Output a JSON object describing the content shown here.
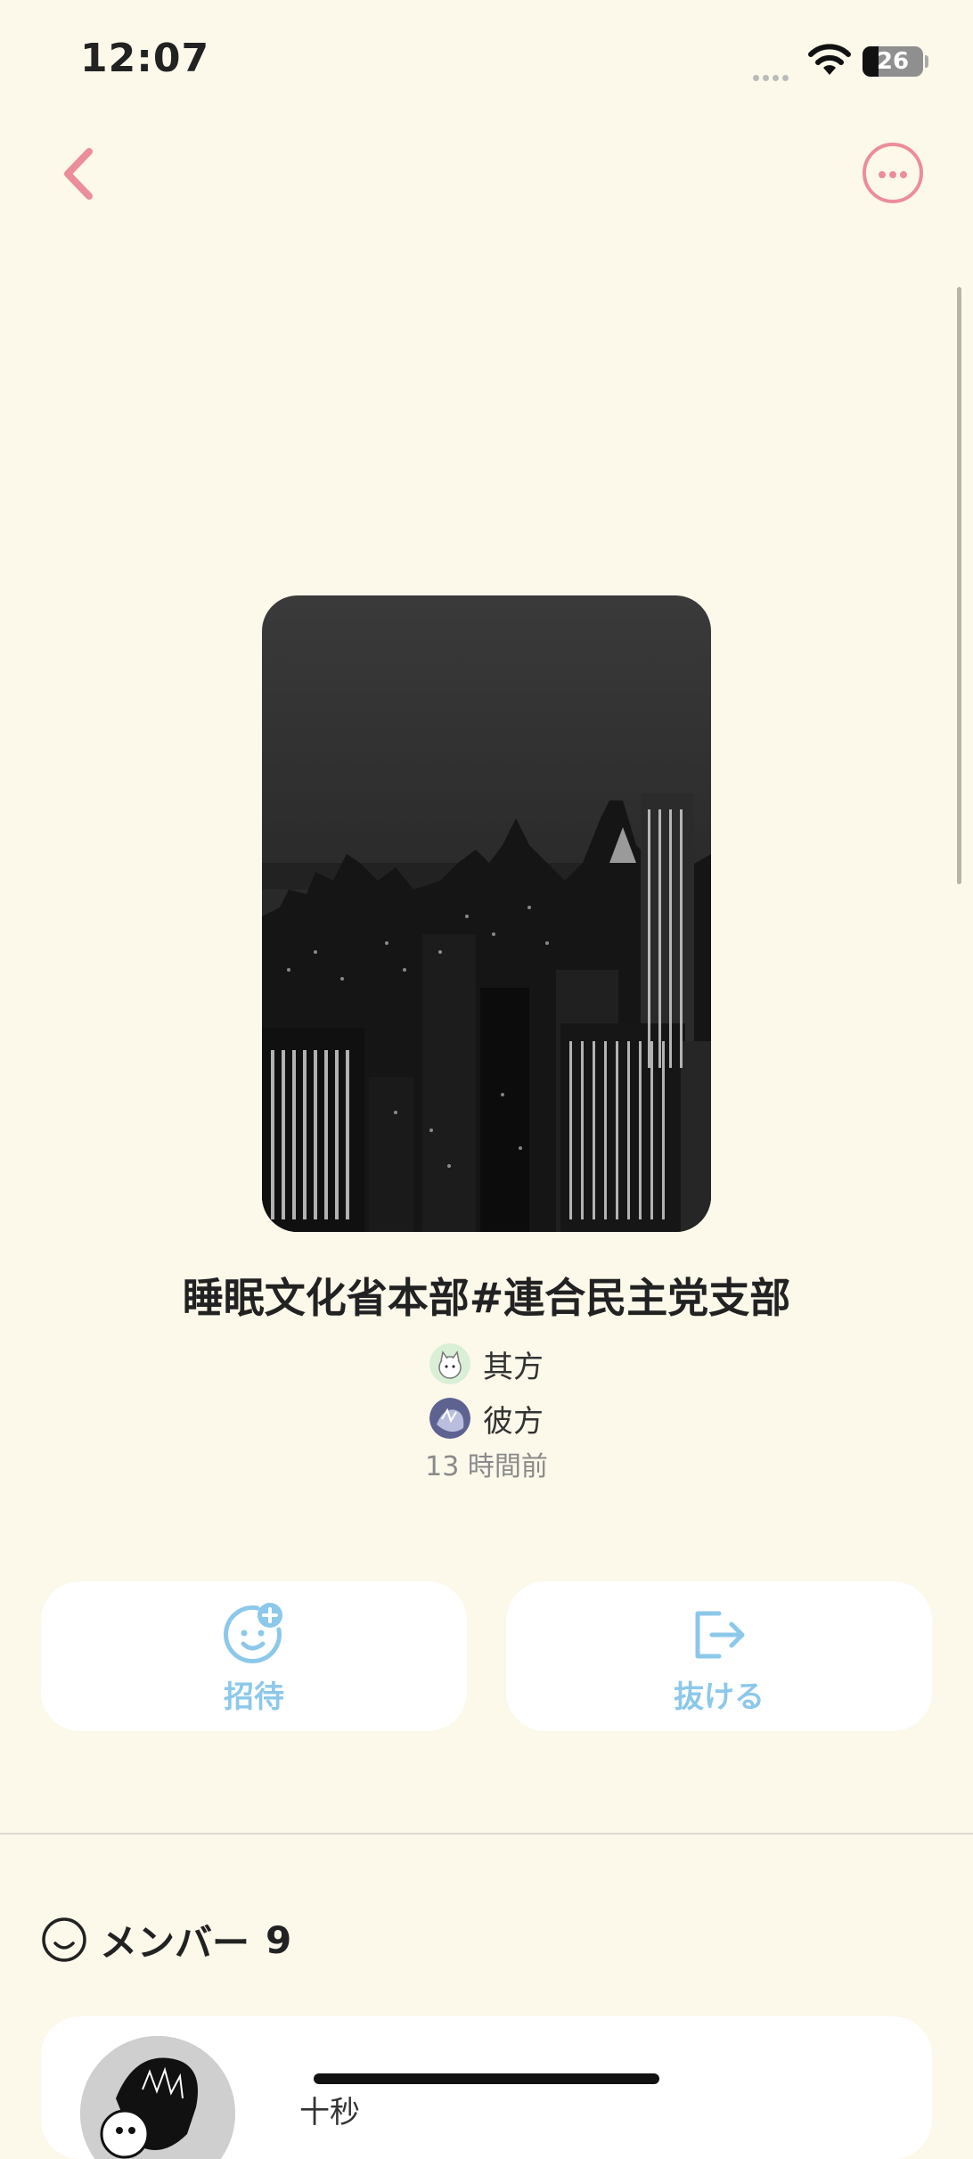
{
  "status_bar": {
    "time": "12:07",
    "battery": "26",
    "battery_fraction": 0.26
  },
  "header": {
    "back_icon": "chevron-left-icon",
    "more_icon": "ellipsis-circle-icon",
    "accent_color": "#eb8d9a"
  },
  "group": {
    "title": "睡眠文化省本部#連合民主党支部",
    "creators": [
      {
        "name": "其方",
        "avatar": "cat-avatar"
      },
      {
        "name": "彼方",
        "avatar": "anime-avatar"
      }
    ],
    "created_ago": "13 時間前"
  },
  "actions": {
    "invite_label": "招待",
    "invite_icon": "smile-plus-icon",
    "leave_label": "抜ける",
    "leave_icon": "exit-icon",
    "color": "#8cc8ea"
  },
  "members": {
    "title": "メンバー",
    "count": "9",
    "icon": "smile-icon",
    "items": [
      {
        "name": "十秒",
        "avatar": "sketch-avatar"
      }
    ]
  }
}
